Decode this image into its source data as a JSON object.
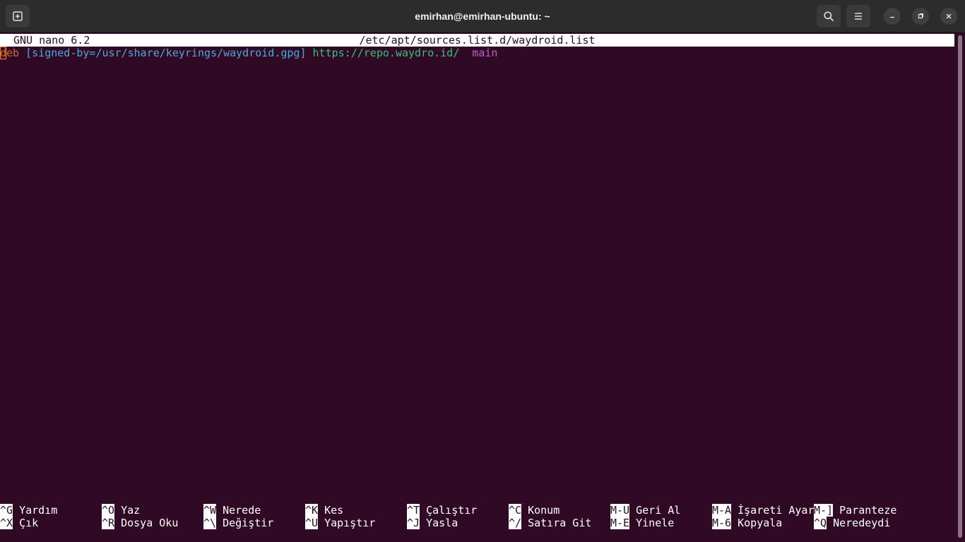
{
  "window": {
    "title": "emirhan@emirhan-ubuntu: ~"
  },
  "icons": {
    "new_tab": "new-tab-icon",
    "search": "search-icon",
    "menu": "hamburger-menu-icon",
    "minimize": "minimize-icon",
    "maximize": "maximize-icon",
    "close": "close-icon"
  },
  "nano": {
    "version": "GNU nano 6.2",
    "filename": "/etc/apt/sources.list.d/waydroid.list",
    "line1": {
      "cursor_char": "d",
      "keyword_rest": "eb",
      "options": "[signed-by=/usr/share/keyrings/waydroid.gpg]",
      "url": "https://repo.waydro.id/",
      "component": "main"
    },
    "shortcuts_row1": [
      {
        "key": "^G",
        "label": "Yardım"
      },
      {
        "key": "^O",
        "label": "Yaz"
      },
      {
        "key": "^W",
        "label": "Nerede"
      },
      {
        "key": "^K",
        "label": "Kes"
      },
      {
        "key": "^T",
        "label": "Çalıştır"
      },
      {
        "key": "^C",
        "label": "Konum"
      },
      {
        "key": "M-U",
        "label": "Geri Al"
      },
      {
        "key": "M-A",
        "label": "İşareti Ayar"
      },
      {
        "key": "M-]",
        "label": "Paranteze"
      }
    ],
    "shortcuts_row2": [
      {
        "key": "^X",
        "label": "Çık"
      },
      {
        "key": "^R",
        "label": "Dosya Oku"
      },
      {
        "key": "^\\",
        "label": "Değiştir"
      },
      {
        "key": "^U",
        "label": "Yapıştır"
      },
      {
        "key": "^J",
        "label": "Yasla"
      },
      {
        "key": "^/",
        "label": "Satıra Git"
      },
      {
        "key": "M-E",
        "label": "Yinele"
      },
      {
        "key": "M-6",
        "label": "Kopyala"
      },
      {
        "key": "^Q",
        "label": "Neredeydi"
      }
    ]
  },
  "colors": {
    "terminal_bg": "#300a24",
    "headerbar_bg": "#2c2c2c",
    "keyword": "#c8693a",
    "options": "#4aa8d8",
    "url": "#2ec27e",
    "component": "#c061cb"
  }
}
